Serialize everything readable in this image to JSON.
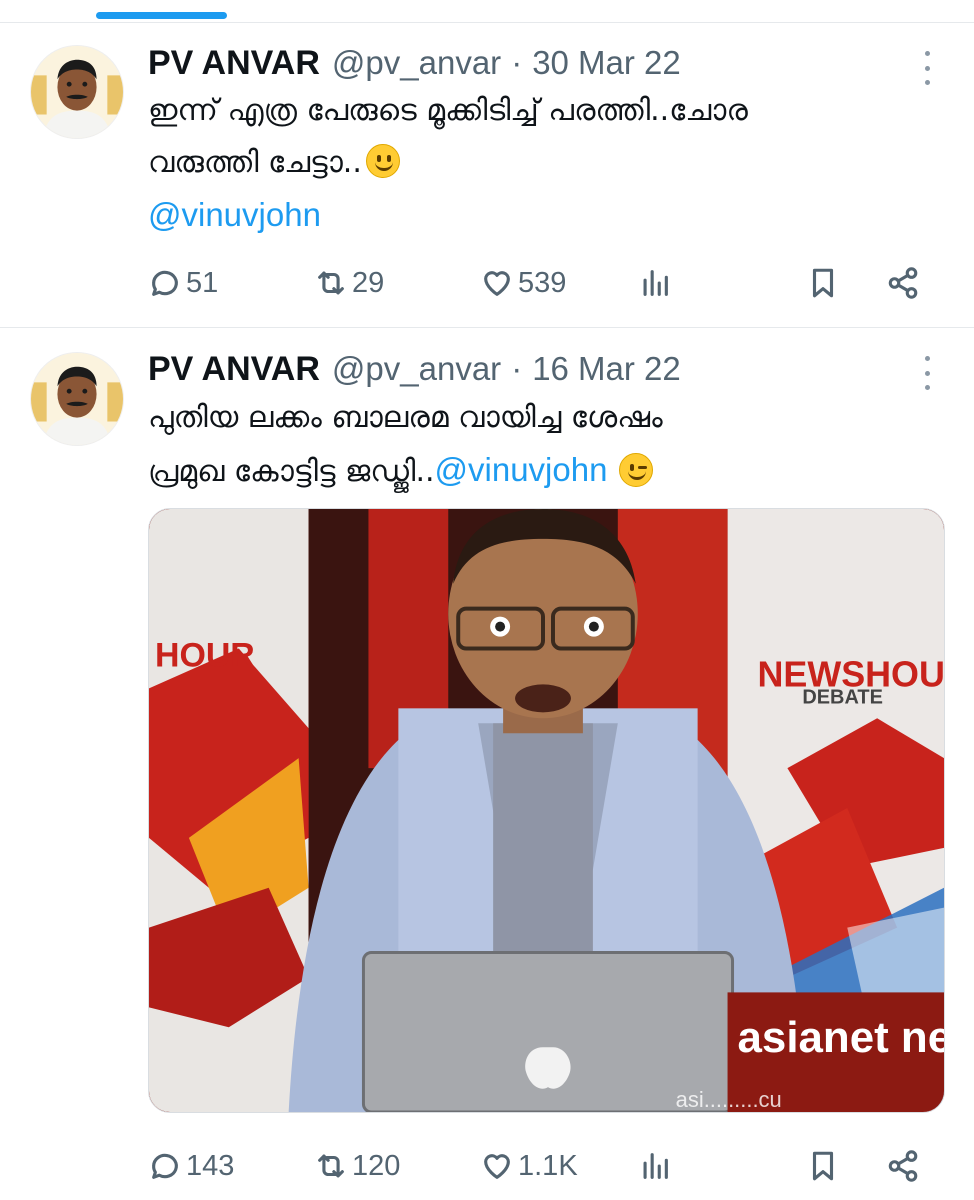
{
  "tweets": [
    {
      "author_name": "PV ANVAR",
      "handle": "@pv_anvar",
      "separator": "·",
      "date": "30 Mar 22",
      "text_line1": "ഇന്ന് എത്ര പേരുടെ മൂക്കിടിച്ച് പരത്തി..ചോര",
      "text_line2": "വരുത്തി ചേട്ടാ..",
      "mention": "@vinuvjohn",
      "emoji": "slightly-smiling-face",
      "replies": "51",
      "retweets": "29",
      "likes": "539"
    },
    {
      "author_name": "PV ANVAR",
      "handle": "@pv_anvar",
      "separator": "·",
      "date": "16 Mar 22",
      "text_line1": "പുതിയ ലക്കം ബാലരമ വായിച്ച ശേഷം",
      "text_line2": "പ്രമുഖ കോട്ടിട്ട ജഡ്ജി..",
      "mention": "@vinuvjohn",
      "emoji": "winking-face",
      "media_logo_text": "NEWSHOUR",
      "media_logo_sub": "DEBATE",
      "media_logo_left": "HOUR",
      "media_brand": "asianet news",
      "media_brand_small": "asi.........cu",
      "replies": "143",
      "retweets": "120",
      "likes": "1.1K"
    }
  ],
  "colors": {
    "accent": "#1d9bf0",
    "secondary_text": "#536471",
    "primary_text": "#0f1419"
  }
}
